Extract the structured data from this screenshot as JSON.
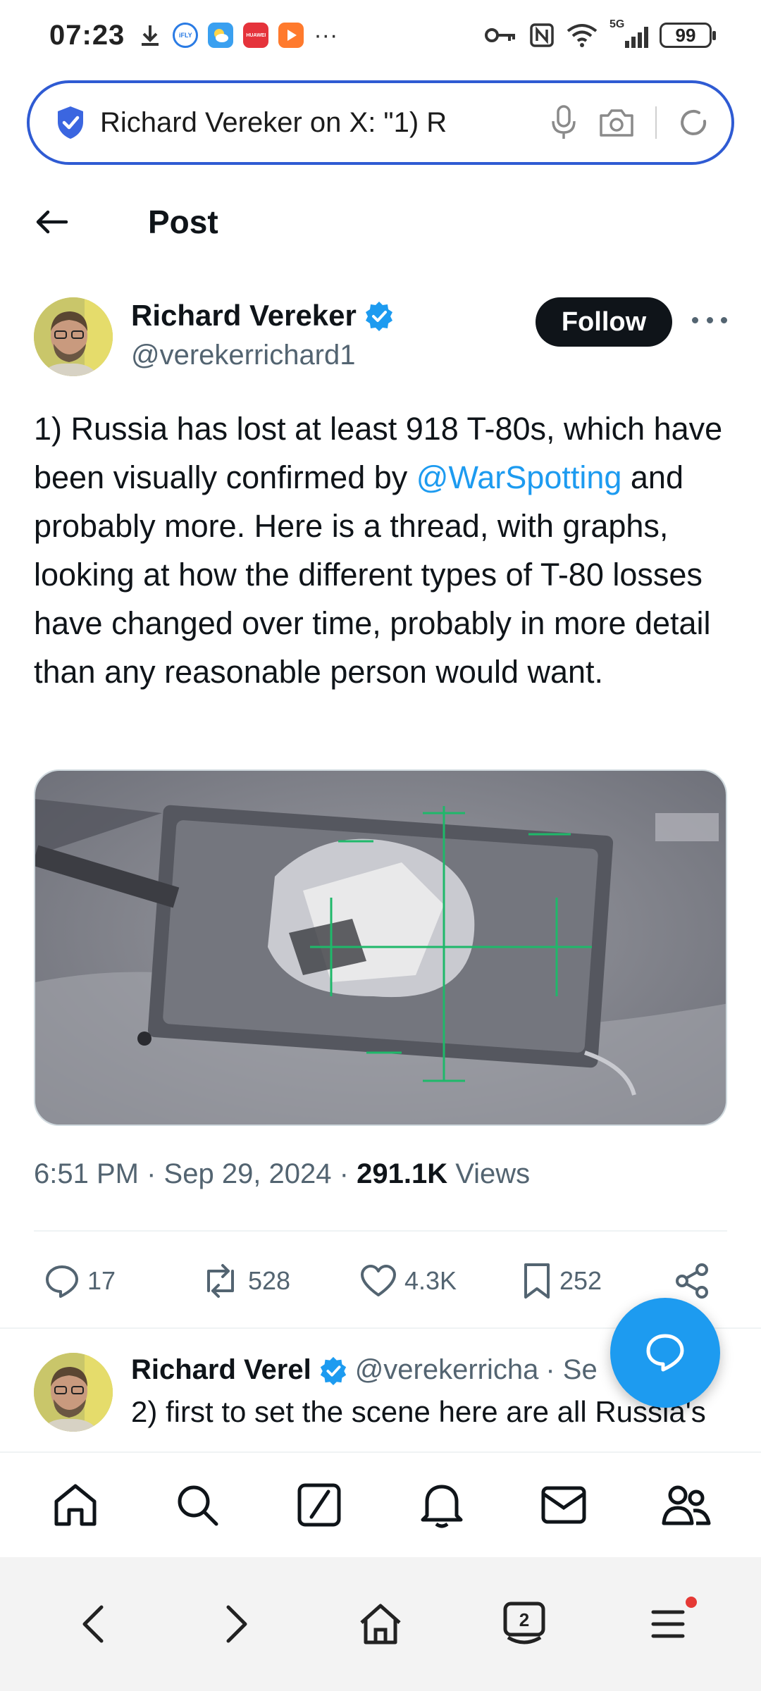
{
  "status_bar": {
    "time": "07:23",
    "battery": "99",
    "network": "5G",
    "more": "···",
    "ifly_label": "iFLY",
    "huawei_label": "HUAWEI"
  },
  "address_bar": {
    "text": "Richard Vereker on X: \"1) R"
  },
  "header": {
    "title": "Post"
  },
  "author": {
    "name": "Richard Vereker",
    "handle": "@verekerrichard1",
    "follow_label": "Follow"
  },
  "tweet": {
    "text_before_mention": "1) Russia has lost at least 918 T-80s, which have been visually confirmed by ",
    "mention": "@WarSpotting",
    "text_after_mention": " and probably more. Here is a thread, with graphs, looking at how the different types of T-80 losses have changed over time, probably in more detail than any reasonable person would want.",
    "time": "6:51 PM",
    "date": "Sep 29, 2024",
    "views_count": "291.1K",
    "views_label": "Views"
  },
  "actions": {
    "replies": "17",
    "reposts": "528",
    "likes": "4.3K",
    "bookmarks": "252"
  },
  "reply": {
    "name": "Richard Verel",
    "handle": "@verekerricha",
    "time_fragment": "· Se",
    "text": "2) first to set the scene here are all Russia's"
  },
  "browser_bar": {
    "tab_count": "2"
  },
  "colors": {
    "accent": "#1d9bf0",
    "text": "#0f1419",
    "muted": "#536471",
    "address_border": "#2f5bd3"
  }
}
